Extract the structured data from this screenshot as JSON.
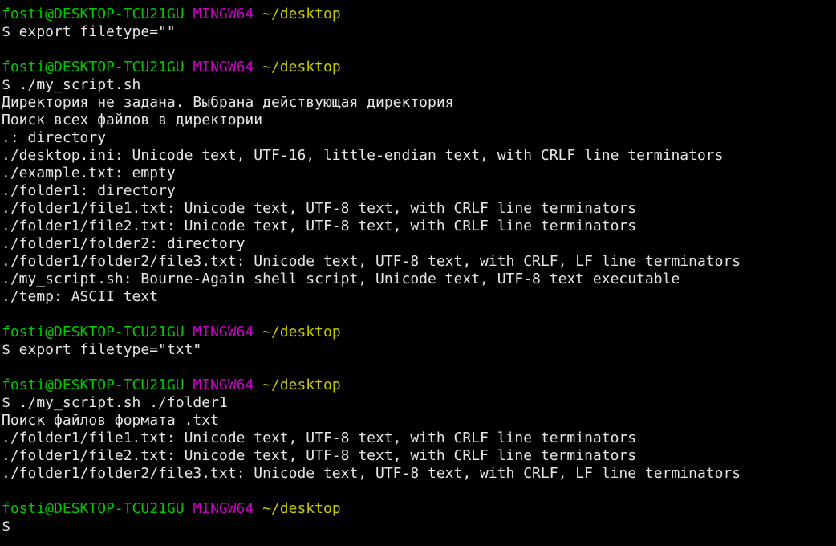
{
  "colors": {
    "background": "#000000",
    "user_host": "#00c800",
    "system": "#c800c8",
    "path": "#c8c800",
    "text": "#e6e6e6"
  },
  "prompt": {
    "user_host": "fosti@DESKTOP-TCU21GU",
    "system": "MINGW64",
    "path": "~/desktop"
  },
  "blocks": [
    {
      "command": "$ export filetype=\"\"",
      "output": []
    },
    {
      "command": "$ ./my_script.sh",
      "output": [
        "Директория не задана. Выбрана действующая директория",
        "Поиск всех файлов в директории",
        ".: directory",
        "./desktop.ini: Unicode text, UTF-16, little-endian text, with CRLF line terminators",
        "./example.txt: empty",
        "./folder1: directory",
        "./folder1/file1.txt: Unicode text, UTF-8 text, with CRLF line terminators",
        "./folder1/file2.txt: Unicode text, UTF-8 text, with CRLF line terminators",
        "./folder1/folder2: directory",
        "./folder1/folder2/file3.txt: Unicode text, UTF-8 text, with CRLF, LF line terminators",
        "./my_script.sh: Bourne-Again shell script, Unicode text, UTF-8 text executable",
        "./temp: ASCII text"
      ]
    },
    {
      "command": "$ export filetype=\"txt\"",
      "output": []
    },
    {
      "command": "$ ./my_script.sh ./folder1",
      "output": [
        "Поиск файлов формата .txt",
        "./folder1/file1.txt: Unicode text, UTF-8 text, with CRLF line terminators",
        "./folder1/file2.txt: Unicode text, UTF-8 text, with CRLF line terminators",
        "./folder1/folder2/file3.txt: Unicode text, UTF-8 text, with CRLF, LF line terminators"
      ]
    },
    {
      "command": "$",
      "output": []
    }
  ]
}
